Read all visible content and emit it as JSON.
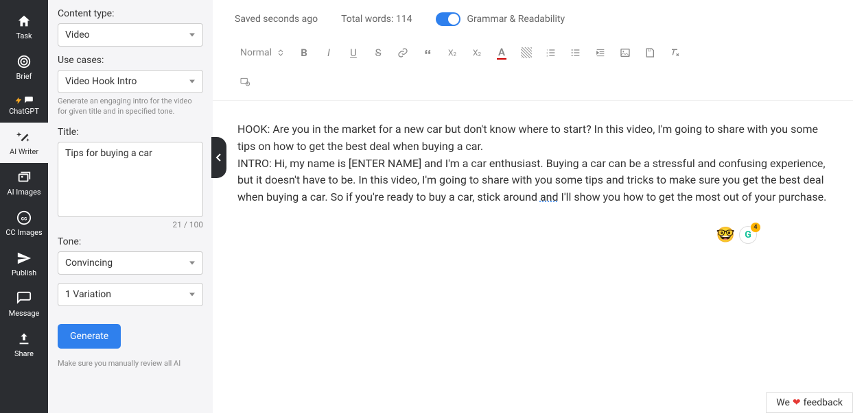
{
  "nav": {
    "items": [
      {
        "label": "Task"
      },
      {
        "label": "Brief"
      },
      {
        "label": "ChatGPT"
      },
      {
        "label": "AI Writer"
      },
      {
        "label": "AI Images"
      },
      {
        "label": "CC Images"
      },
      {
        "label": "Publish"
      },
      {
        "label": "Message"
      },
      {
        "label": "Share"
      }
    ]
  },
  "panel": {
    "content_type_label": "Content type:",
    "content_type_value": "Video",
    "use_cases_label": "Use cases:",
    "use_cases_value": "Video Hook Intro",
    "use_cases_helper": "Generate an engaging intro for the video for given title and in specified tone.",
    "title_label": "Title:",
    "title_value": "Tips for buying a car",
    "char_count": "21 / 100",
    "tone_label": "Tone:",
    "tone_value": "Convincing",
    "variation_value": "1 Variation",
    "generate_label": "Generate",
    "review_note": "Make sure you manually review all AI"
  },
  "header": {
    "saved": "Saved seconds ago",
    "total_words": "Total words: 114",
    "grammar_label": "Grammar & Readability"
  },
  "toolbar": {
    "style_label": "Normal"
  },
  "content": {
    "hook": "HOOK: Are you in the market for a new car but don't know where to start? In this video, I'm going to share with you some tips on how to get the best deal when buying a car.",
    "intro_p1": "INTRO: Hi, my name is [ENTER NAME] and I'm a car enthusiast. Buying a car can be a stressful and confusing experience, but it doesn't have to be. In this video, I'm going to share with you some tips and tricks to make sure you get the best deal when buying a car. So if you're ready to buy a car, stick around ",
    "intro_and": "and",
    "intro_p2": " I'll show you how to get the most out of your purchase."
  },
  "badges": {
    "grammarly_count": "4"
  },
  "feedback": {
    "pre": "We ",
    "post": " feedback"
  }
}
